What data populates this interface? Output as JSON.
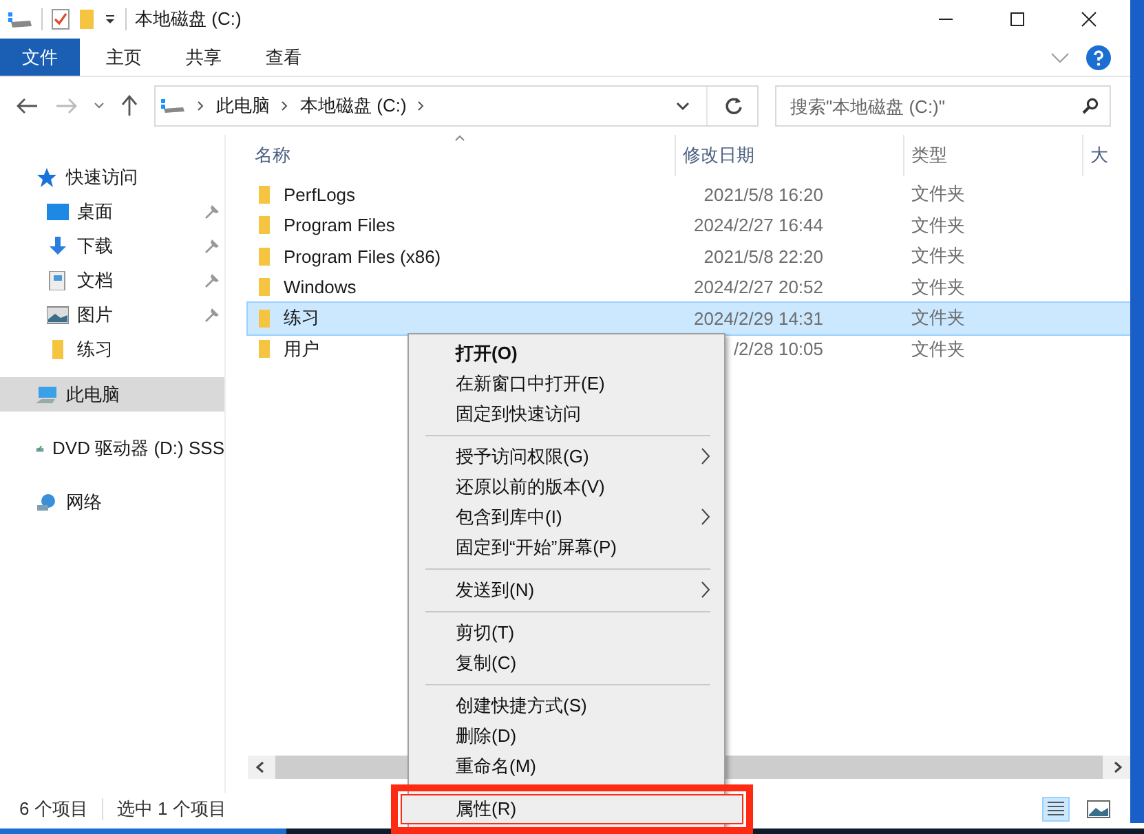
{
  "window": {
    "title": "本地磁盘 (C:)"
  },
  "ribbon_tabs": [
    {
      "label": "文件",
      "selected": true
    },
    {
      "label": "主页",
      "selected": false
    },
    {
      "label": "共享",
      "selected": false
    },
    {
      "label": "查看",
      "selected": false
    }
  ],
  "address": {
    "path": [
      "此电脑",
      "本地磁盘 (C:)"
    ]
  },
  "search": {
    "placeholder": "搜索\"本地磁盘 (C:)\""
  },
  "sidebar": {
    "items": [
      {
        "label": "快速访问",
        "selected": false,
        "children": [
          {
            "label": "桌面",
            "pinned": true,
            "selected": false
          },
          {
            "label": "下载",
            "pinned": true,
            "selected": false
          },
          {
            "label": "文档",
            "pinned": true,
            "selected": false
          },
          {
            "label": "图片",
            "pinned": true,
            "selected": false
          },
          {
            "label": "练习",
            "pinned": false,
            "selected": false
          }
        ]
      },
      {
        "label": "此电脑",
        "selected": true
      },
      {
        "label": "DVD 驱动器 (D:) SSS",
        "selected": false
      },
      {
        "label": "网络",
        "selected": false
      }
    ]
  },
  "table": {
    "columns": [
      "名称",
      "修改日期",
      "类型",
      "大"
    ],
    "rows": [
      {
        "name": "PerfLogs",
        "date": "2021/5/8 16:20",
        "type": "文件夹",
        "selected": false
      },
      {
        "name": "Program Files",
        "date": "2024/2/27 16:44",
        "type": "文件夹",
        "selected": false
      },
      {
        "name": "Program Files (x86)",
        "date": "2021/5/8 22:20",
        "type": "文件夹",
        "selected": false
      },
      {
        "name": "Windows",
        "date": "2024/2/27 20:52",
        "type": "文件夹",
        "selected": false
      },
      {
        "name": "练习",
        "date": "2024/2/29 14:31",
        "type": "文件夹",
        "selected": true
      },
      {
        "name": "用户",
        "date": "/2/28 10:05",
        "type": "文件夹",
        "selected": false
      }
    ]
  },
  "context_menu": {
    "groups": [
      [
        {
          "label": "打开(O)",
          "bold": true,
          "submenu": false,
          "highlighted": false
        },
        {
          "label": "在新窗口中打开(E)",
          "bold": false,
          "submenu": false,
          "highlighted": false
        },
        {
          "label": "固定到快速访问",
          "bold": false,
          "submenu": false,
          "highlighted": false
        }
      ],
      [
        {
          "label": "授予访问权限(G)",
          "bold": false,
          "submenu": true,
          "highlighted": false
        },
        {
          "label": "还原以前的版本(V)",
          "bold": false,
          "submenu": false,
          "highlighted": false
        },
        {
          "label": "包含到库中(I)",
          "bold": false,
          "submenu": true,
          "highlighted": false
        },
        {
          "label": "固定到“开始”屏幕(P)",
          "bold": false,
          "submenu": false,
          "highlighted": false
        }
      ],
      [
        {
          "label": "发送到(N)",
          "bold": false,
          "submenu": true,
          "highlighted": false
        }
      ],
      [
        {
          "label": "剪切(T)",
          "bold": false,
          "submenu": false,
          "highlighted": false
        },
        {
          "label": "复制(C)",
          "bold": false,
          "submenu": false,
          "highlighted": false
        }
      ],
      [
        {
          "label": "创建快捷方式(S)",
          "bold": false,
          "submenu": false,
          "highlighted": false
        },
        {
          "label": "删除(D)",
          "bold": false,
          "submenu": false,
          "highlighted": false
        },
        {
          "label": "重命名(M)",
          "bold": false,
          "submenu": false,
          "highlighted": false
        }
      ],
      [
        {
          "label": "属性(R)",
          "bold": false,
          "submenu": false,
          "highlighted": true
        }
      ]
    ]
  },
  "status_bar": {
    "item_count": "6 个项目",
    "selection": "选中 1 个项目"
  }
}
